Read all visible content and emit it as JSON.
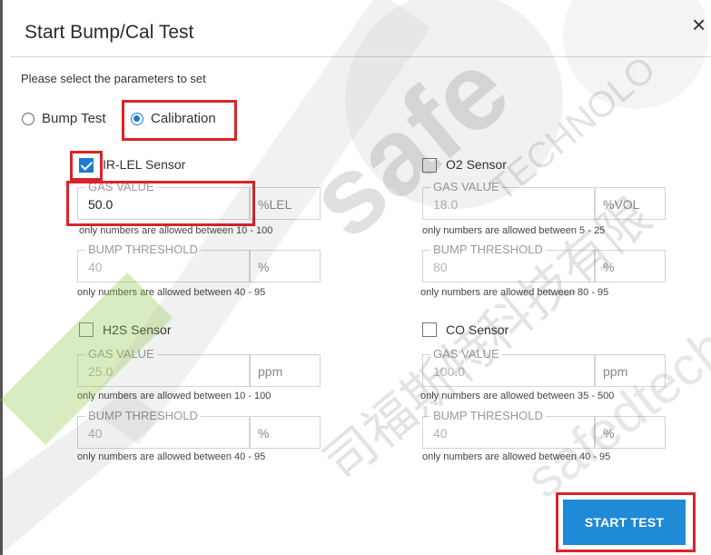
{
  "dialog": {
    "title": "Start Bump/Cal Test",
    "close_glyph": "×",
    "instructions": "Please select the parameters to set"
  },
  "mode": {
    "options": [
      {
        "label": "Bump Test",
        "selected": false
      },
      {
        "label": "Calibration",
        "selected": true
      }
    ]
  },
  "sensors": {
    "ir_lel": {
      "label": "IR-LEL Sensor",
      "checked": true,
      "gas_value": {
        "legend": "GAS VALUE",
        "value": "50.0",
        "unit": "%LEL",
        "hint": "only numbers are allowed between 10 - 100"
      },
      "bump_threshold": {
        "legend": "BUMP THRESHOLD",
        "value": "40",
        "unit": "%",
        "hint": "only numbers are allowed between 40 - 95"
      }
    },
    "o2": {
      "label": "O2 Sensor",
      "checked": false,
      "gas_value": {
        "legend": "GAS VALUE",
        "value": "18.0",
        "unit": "%VOL",
        "hint": "only numbers are allowed between 5 - 25"
      },
      "bump_threshold": {
        "legend": "BUMP THRESHOLD",
        "value": "80",
        "unit": "%",
        "hint": "only numbers are allowed between 80 - 95"
      }
    },
    "h2s": {
      "label": "H2S Sensor",
      "checked": false,
      "gas_value": {
        "legend": "GAS VALUE",
        "value": "25.0",
        "unit": "ppm",
        "hint": "only numbers are allowed between 10 - 100"
      },
      "bump_threshold": {
        "legend": "BUMP THRESHOLD",
        "value": "40",
        "unit": "%",
        "hint": "only numbers are allowed between 40 - 95"
      }
    },
    "co": {
      "label": "CO Sensor",
      "checked": false,
      "gas_value": {
        "legend": "GAS VALUE",
        "value": "100.0",
        "unit": "ppm",
        "hint": "only numbers are allowed between 35 - 500"
      },
      "bump_threshold": {
        "legend": "BUMP THRESHOLD",
        "value": "40",
        "unit": "%",
        "hint": "only numbers are allowed between 40 - 95"
      }
    }
  },
  "actions": {
    "start_label": "START TEST",
    "accent_color": "#1f8ad6"
  },
  "annotation": {
    "highlight_color": "#d9242a"
  },
  "watermark": {
    "brand": "safe",
    "text_cn": "司福斯特科技有限",
    "text_en": "TECHNOLO",
    "url": "safedtech"
  }
}
